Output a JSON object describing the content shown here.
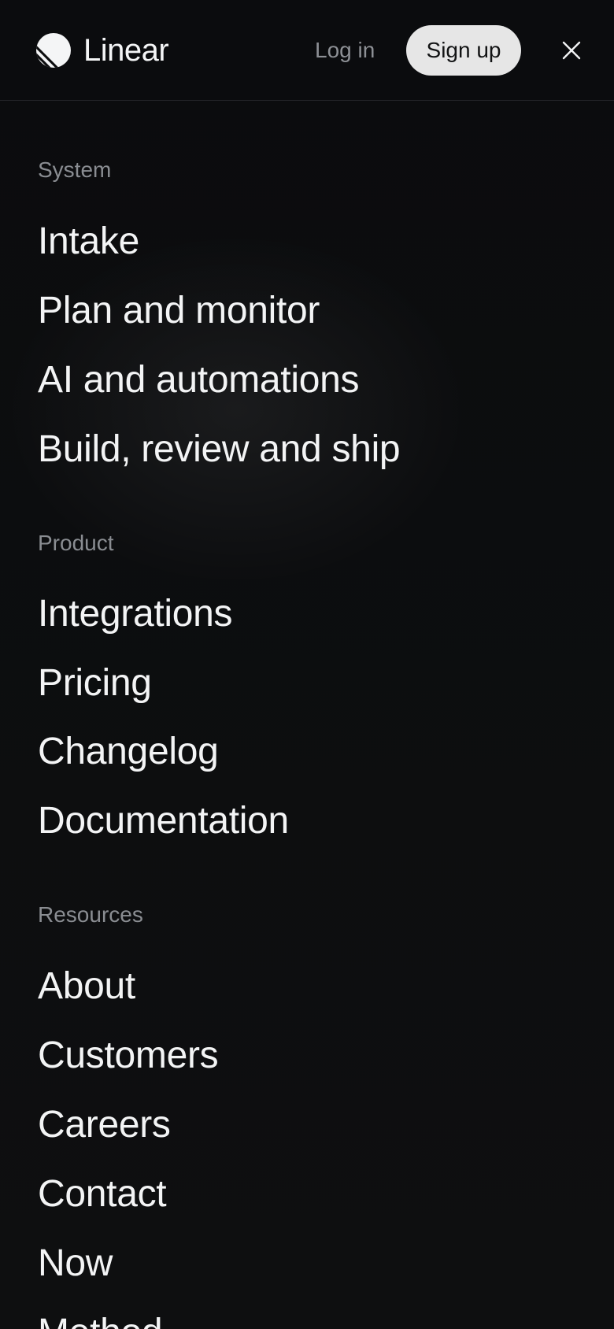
{
  "header": {
    "logo_text": "Linear",
    "login_label": "Log in",
    "signup_label": "Sign up"
  },
  "menu": {
    "sections": [
      {
        "title": "System",
        "items": [
          "Intake",
          "Plan and monitor",
          "AI and automations",
          "Build, review and ship"
        ]
      },
      {
        "title": "Product",
        "items": [
          "Integrations",
          "Pricing",
          "Changelog",
          "Documentation"
        ]
      },
      {
        "title": "Resources",
        "items": [
          "About",
          "Customers",
          "Careers",
          "Contact",
          "Now",
          "Method"
        ]
      }
    ]
  },
  "colors": {
    "background": "#0c0d0e",
    "text_primary": "#f3f4f5",
    "text_muted": "#8a8d92",
    "button_bg": "#e6e6e6",
    "button_text": "#121314"
  },
  "icons": {
    "logo": "linear-logo-icon",
    "close": "close-icon"
  }
}
